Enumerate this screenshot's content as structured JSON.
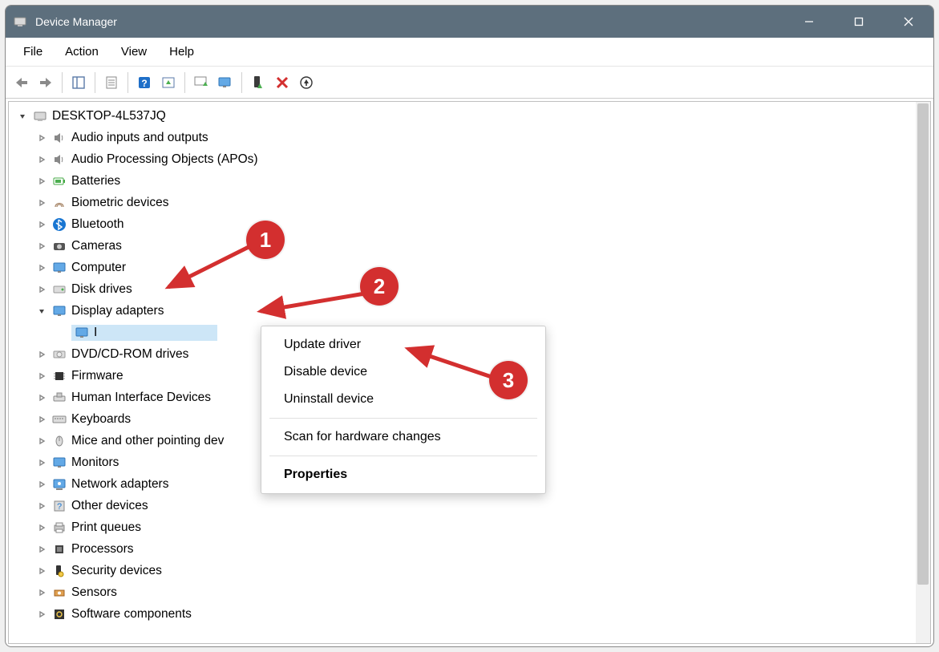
{
  "window": {
    "title": "Device Manager"
  },
  "menu": {
    "file": "File",
    "action": "Action",
    "view": "View",
    "help": "Help"
  },
  "tree": {
    "root": "DESKTOP-4L537JQ",
    "items": [
      {
        "label": "Audio inputs and outputs",
        "icon": "speaker"
      },
      {
        "label": "Audio Processing Objects (APOs)",
        "icon": "speaker"
      },
      {
        "label": "Batteries",
        "icon": "battery"
      },
      {
        "label": "Biometric devices",
        "icon": "fingerprint"
      },
      {
        "label": "Bluetooth",
        "icon": "bluetooth"
      },
      {
        "label": "Cameras",
        "icon": "camera"
      },
      {
        "label": "Computer",
        "icon": "monitor"
      },
      {
        "label": "Disk drives",
        "icon": "disk"
      },
      {
        "label": "Display adapters",
        "icon": "monitor",
        "expanded": true,
        "children": [
          {
            "label": "I",
            "icon": "monitor",
            "selected": true
          }
        ]
      },
      {
        "label": "DVD/CD-ROM drives",
        "icon": "optical"
      },
      {
        "label": "Firmware",
        "icon": "chip"
      },
      {
        "label": "Human Interface Devices",
        "icon": "hid"
      },
      {
        "label": "Keyboards",
        "icon": "keyboard"
      },
      {
        "label": "Mice and other pointing dev",
        "icon": "mouse"
      },
      {
        "label": "Monitors",
        "icon": "monitor"
      },
      {
        "label": "Network adapters",
        "icon": "network"
      },
      {
        "label": "Other devices",
        "icon": "other"
      },
      {
        "label": "Print queues",
        "icon": "printer"
      },
      {
        "label": "Processors",
        "icon": "cpu"
      },
      {
        "label": "Security devices",
        "icon": "security"
      },
      {
        "label": "Sensors",
        "icon": "sensor"
      },
      {
        "label": "Software components",
        "icon": "software"
      }
    ]
  },
  "context_menu": {
    "update": "Update driver",
    "disable": "Disable device",
    "uninstall": "Uninstall device",
    "scan": "Scan for hardware changes",
    "properties": "Properties"
  },
  "annotations": {
    "b1": "1",
    "b2": "2",
    "b3": "3"
  }
}
